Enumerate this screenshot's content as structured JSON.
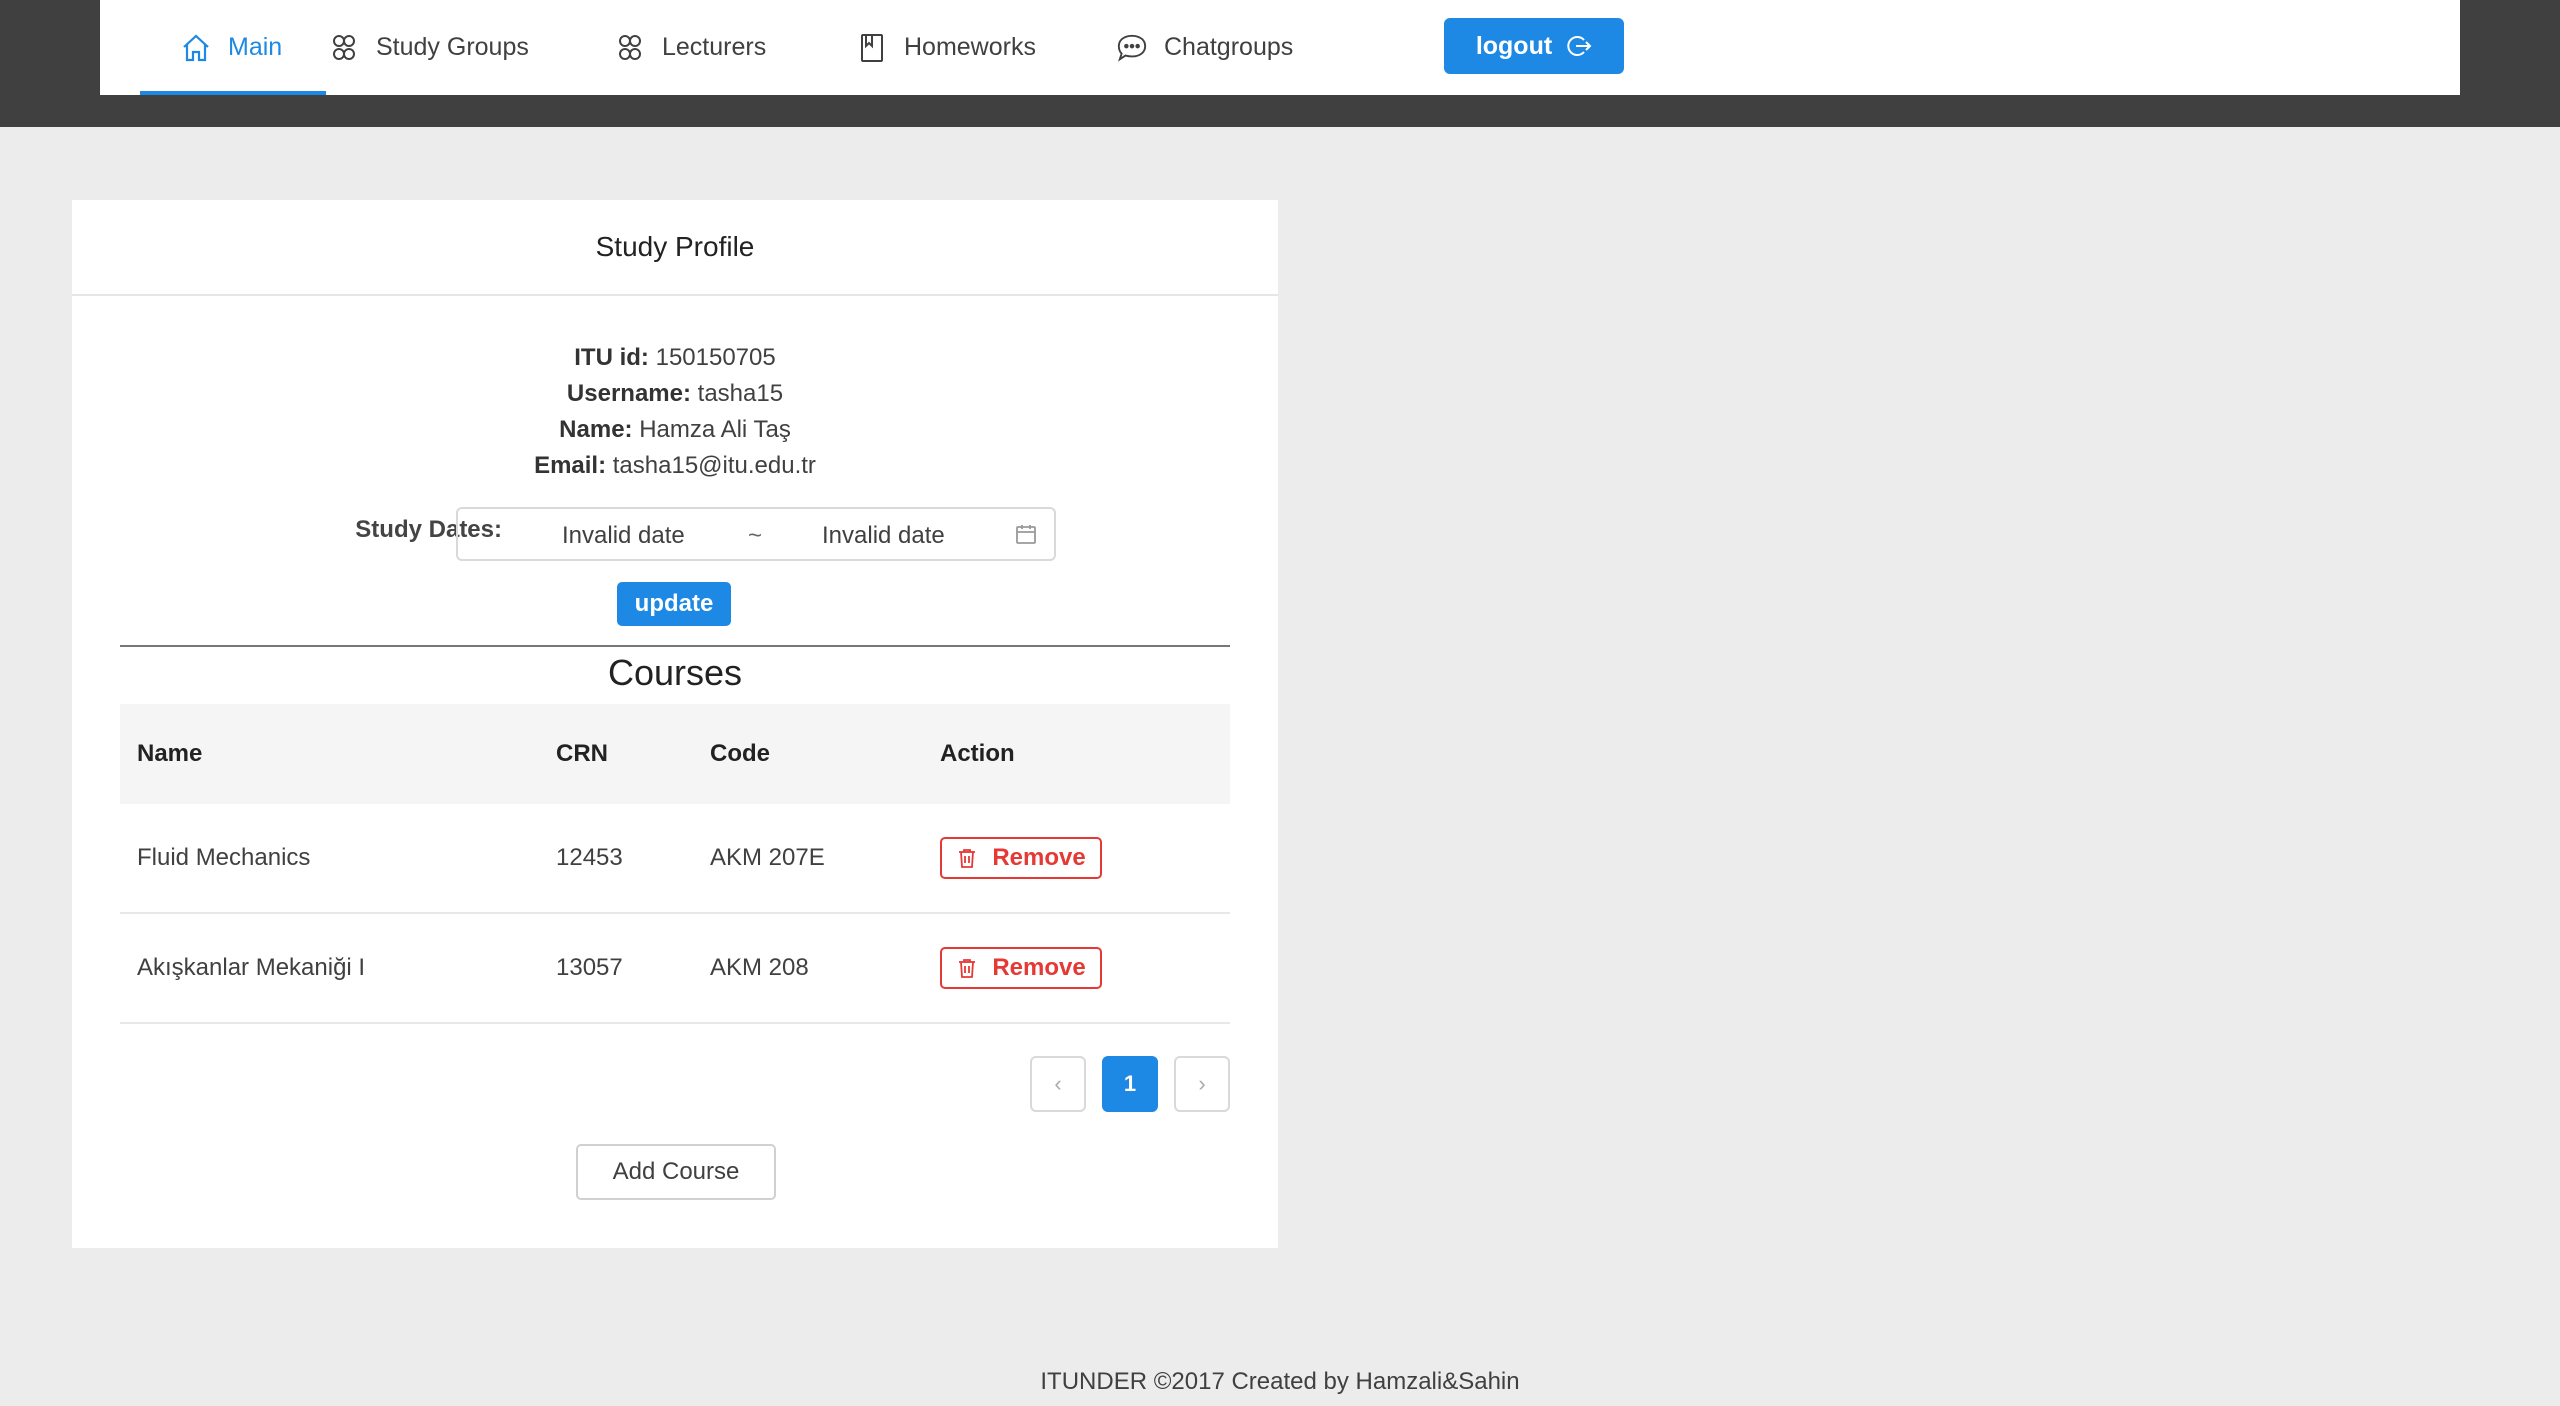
{
  "nav": {
    "items": [
      {
        "label": "Main",
        "icon": "home-icon",
        "active": true
      },
      {
        "label": "Study Groups",
        "icon": "group-icon"
      },
      {
        "label": "Lecturers",
        "icon": "group-icon"
      },
      {
        "label": "Homeworks",
        "icon": "book-icon"
      },
      {
        "label": "Chatgroups",
        "icon": "chat-icon"
      }
    ],
    "logout_label": "logout"
  },
  "profile": {
    "title": "Study Profile",
    "itu_id_label": "ITU id:",
    "itu_id": "150150705",
    "username_label": "Username:",
    "username": "tasha15",
    "name_label": "Name:",
    "name": "Hamza Ali Taş",
    "email_label": "Email:",
    "email": "tasha15@itu.edu.tr",
    "dates_label": "Study Dates:",
    "date_start": "Invalid date",
    "date_separator": "~",
    "date_end": "Invalid date",
    "update_label": "update"
  },
  "courses": {
    "title": "Courses",
    "columns": [
      "Name",
      "CRN",
      "Code",
      "Action"
    ],
    "rows": [
      {
        "name": "Fluid Mechanics",
        "crn": "12453",
        "code": "AKM 207E",
        "action": "Remove"
      },
      {
        "name": "Akışkanlar Mekaniği I",
        "crn": "13057",
        "code": "AKM 208",
        "action": "Remove"
      }
    ],
    "pagination": {
      "prev": "‹",
      "current": "1",
      "next": "›"
    },
    "add_label": "Add Course"
  },
  "footer": {
    "text": "ITUNDER ©2017 Created by Hamzali&Sahin"
  },
  "colors": {
    "accent": "#1e88e5",
    "danger": "#e53935",
    "header_bg": "#404040",
    "page_bg": "#ececec"
  }
}
